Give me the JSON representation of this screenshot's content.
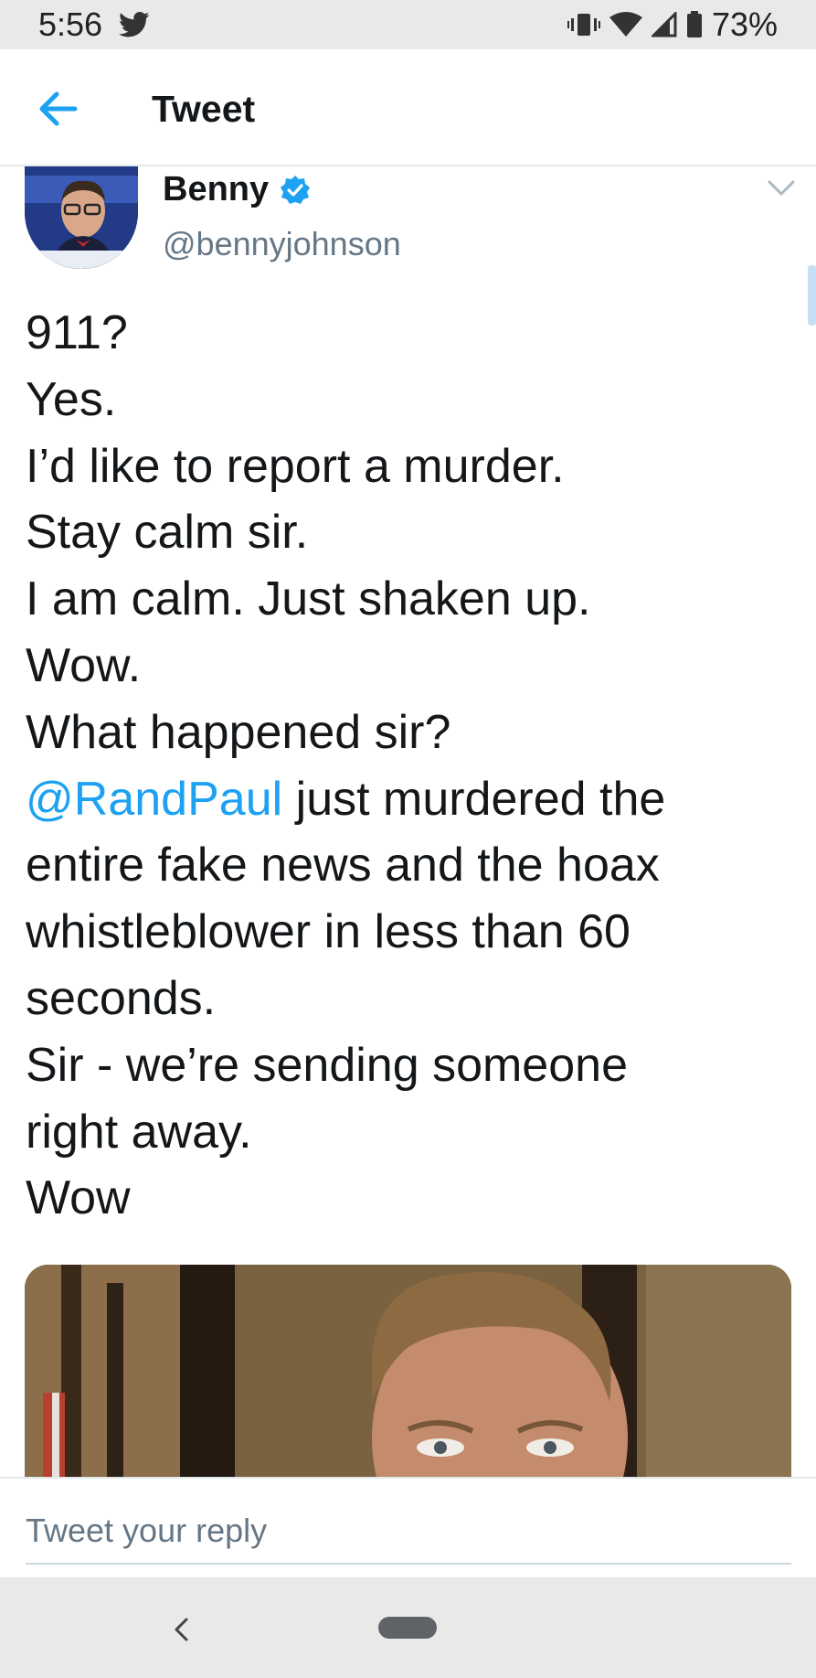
{
  "status_bar": {
    "time": "5:56",
    "battery": "73%"
  },
  "header": {
    "title": "Tweet"
  },
  "tweet": {
    "author_name": "Benny",
    "handle": "@bennyjohnson",
    "lines": [
      "911?",
      "Yes.",
      "I’d like to report a murder.",
      "Stay calm sir.",
      "I am calm. Just shaken up.",
      "Wow.",
      "What happened sir?"
    ],
    "mention": "@RandPaul",
    "mention_line_rest": " just murdered the",
    "lines_after": [
      "entire fake news and the hoax",
      "whistleblower in less than 60",
      "seconds.",
      "Sir - we’re sending someone",
      "right away.",
      "Wow"
    ]
  },
  "reply": {
    "placeholder": "Tweet your reply"
  },
  "colors": {
    "accent": "#1da1f2",
    "text": "#14171a",
    "muted": "#657786"
  }
}
